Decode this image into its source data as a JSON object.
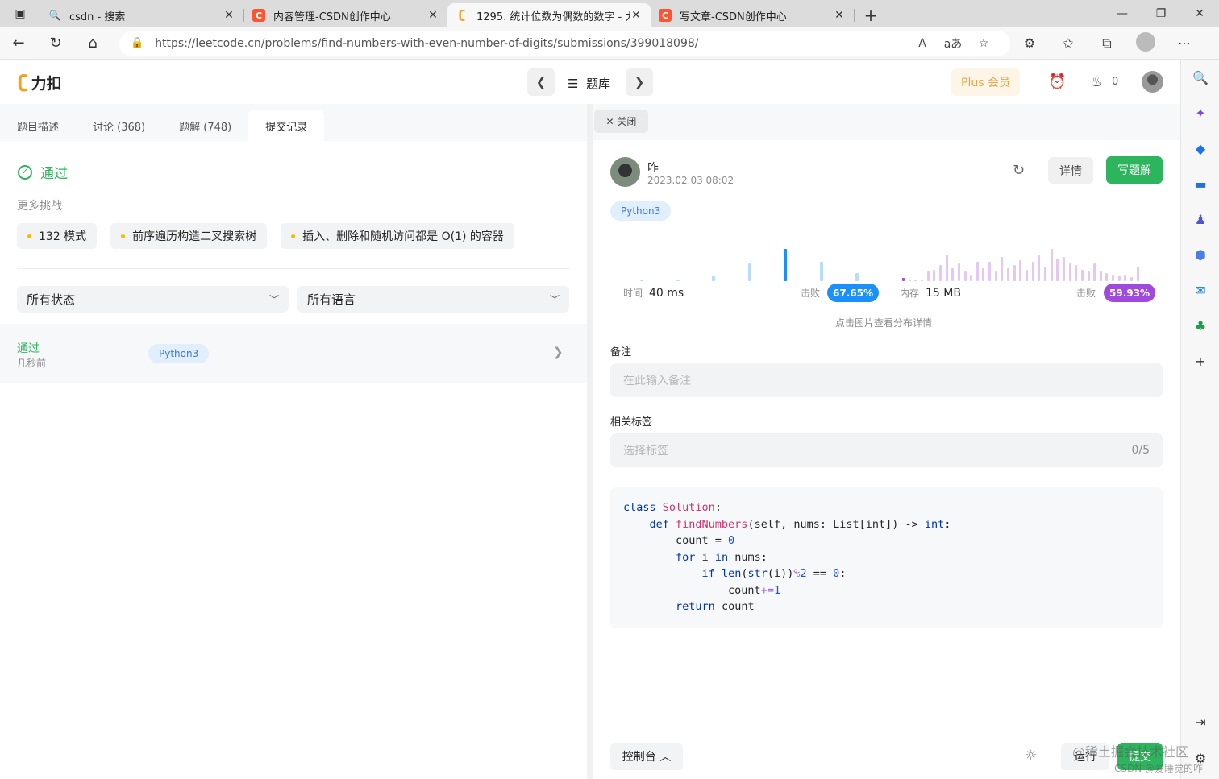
{
  "browser": {
    "tabs": [
      {
        "title": "csdn - 搜索",
        "favicon": "bing-search-icon",
        "active": false
      },
      {
        "title": "内容管理-CSDN创作中心",
        "favicon": "csdn-icon",
        "active": false
      },
      {
        "title": "1295. 统计位数为偶数的数字 - 力",
        "favicon": "leetcode-icon",
        "active": true
      },
      {
        "title": "写文章-CSDN创作中心",
        "favicon": "csdn-icon",
        "active": false
      }
    ],
    "url": "https://leetcode.cn/problems/find-numbers-with-even-number-of-digits/submissions/399018098/",
    "read_aloud_label": "A",
    "translate_label": "aあ"
  },
  "header": {
    "logo_text": "力扣",
    "problem_bank": "题库",
    "plus_label": "Plus 会员",
    "streak_count": "0"
  },
  "left": {
    "tabs": [
      "题目描述",
      "讨论 (368)",
      "题解 (748)",
      "提交记录"
    ],
    "active_tab": 3,
    "status": "通过",
    "more_challenges": "更多挑战",
    "challenges": [
      "132 模式",
      "前序遍历构造二叉搜索树",
      "插入、删除和随机访问都是 O(1) 的容器"
    ],
    "filter_status": "所有状态",
    "filter_lang": "所有语言",
    "submission": {
      "status": "通过",
      "time": "几秒前",
      "lang": "Python3"
    }
  },
  "right": {
    "close_label": "关闭",
    "user": "咋",
    "date": "2023.02.03 08:02",
    "detail_btn": "详情",
    "write_btn": "写题解",
    "lang": "Python3",
    "runtime_label": "时间",
    "runtime": "40 ms",
    "beat_label": "击败",
    "runtime_beat": "67.65%",
    "memory_label": "内存",
    "memory": "15 MB",
    "memory_beat": "59.93%",
    "dist_hint": "点击图片查看分布详情",
    "note_label": "备注",
    "note_placeholder": "在此输入备注",
    "tags_label": "相关标签",
    "tags_placeholder": "选择标签",
    "tags_count": "0/5",
    "console_label": "控制台",
    "run_label": "运行",
    "submit_label": "提交",
    "colors": {
      "runtime_accent": "#1a90ff",
      "memory_accent": "#a149df",
      "success": "#2db55d"
    }
  },
  "runtime_dist": [
    {
      "level": 0.04,
      "highlight": false
    },
    {
      "level": 0.05,
      "highlight": false
    },
    {
      "level": 0.16,
      "highlight": false
    },
    {
      "level": 0.55,
      "highlight": false
    },
    {
      "level": 1.0,
      "highlight": true
    },
    {
      "level": 0.6,
      "highlight": false
    },
    {
      "level": 0.25,
      "highlight": false
    }
  ],
  "memory_dist": [
    0.1,
    0.04,
    0.04,
    0.06,
    0.3,
    0.35,
    0.5,
    0.8,
    0.4,
    0.55,
    0.3,
    0.2,
    0.6,
    0.4,
    0.6,
    0.3,
    0.75,
    0.4,
    0.5,
    0.65,
    0.35,
    0.6,
    0.8,
    0.45,
    1.0,
    0.7,
    0.75,
    0.55,
    0.5,
    0.35,
    0.3,
    0.55,
    0.3,
    0.25,
    0.2,
    0.18,
    0.2,
    0.12,
    0.45
  ],
  "memory_dist_highlight": 0,
  "code_lines": [
    [
      [
        "kw",
        "class "
      ],
      [
        "fn",
        "Solution"
      ],
      [
        "",
        ":"
      ]
    ],
    [
      [
        "",
        "    "
      ],
      [
        "kw",
        "def "
      ],
      [
        "fn",
        "findNumbers"
      ],
      [
        "",
        "(self, nums: List[int]) -> "
      ],
      [
        "kw",
        "int"
      ],
      [
        "",
        ":"
      ]
    ],
    [
      [
        "",
        "        count = "
      ],
      [
        "num",
        "0"
      ]
    ],
    [
      [
        "",
        "        "
      ],
      [
        "kw",
        "for "
      ],
      [
        "",
        "i "
      ],
      [
        "kw",
        "in "
      ],
      [
        "",
        "nums:"
      ]
    ],
    [
      [
        "",
        "            "
      ],
      [
        "kw",
        "if "
      ],
      [
        "kw",
        "len"
      ],
      [
        "",
        "("
      ],
      [
        "kw",
        "str"
      ],
      [
        "",
        "(i))"
      ],
      [
        "op",
        "%"
      ],
      [
        "num",
        "2"
      ],
      [
        "",
        " == "
      ],
      [
        "num",
        "0"
      ],
      [
        "",
        ":"
      ]
    ],
    [
      [
        "",
        "                count"
      ],
      [
        "op",
        "+="
      ],
      [
        "num",
        "1"
      ]
    ],
    [
      [
        "",
        "        "
      ],
      [
        "kw",
        "return "
      ],
      [
        "",
        "count"
      ]
    ]
  ],
  "watermark": {
    "line1": "@稀土掘金技术社区",
    "line2": "CSDN @爱睡觉的咋"
  }
}
